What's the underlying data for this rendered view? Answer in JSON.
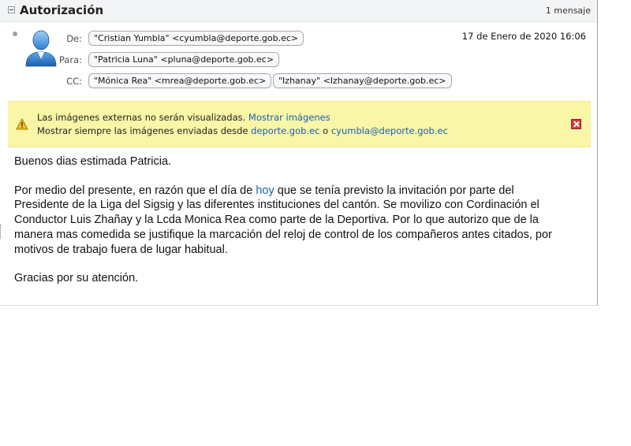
{
  "subject": "Autorización",
  "message_count": "1 mensaje",
  "header": {
    "from_label": "De:",
    "from": "\"Cristian Yumbla\" <cyumbla@deporte.gob.ec>",
    "to_label": "Para:",
    "to": "\"Patricia Luna\" <pluna@deporte.gob.ec>",
    "cc_label": "CC:",
    "cc": [
      "\"Mónica Rea\" <mrea@deporte.gob.ec>",
      "\"Izhanay\" <Izhanay@deporte.gob.ec>"
    ],
    "date": "17 de Enero de 2020 16:06"
  },
  "banner": {
    "line1_text": "Las imágenes externas no serán visualizadas.",
    "show_images_link": "Mostrar imágenes",
    "line2_text": "Mostrar siempre las imágenes enviadas desde",
    "domain_link": "deporte.gob.ec",
    "or_text": "o",
    "sender_link": "cyumbla@deporte.gob.ec"
  },
  "body": {
    "greeting": "Buenos dias estimada Patricia.",
    "para_before_link": "Por medio del presente, en razón que el día de",
    "para_link": "hoy",
    "para_after_link": "que se tenía previsto la invitación por parte del Presidente de la Liga del Sigsig y las diferentes instituciones del cantón. Se movilizo con Cordinación el Conductor Luis Zhañay y la Lcda Monica Rea como parte de la Deportiva. Por lo que autorizo que de la manera mas comedida se justifique la marcación del reloj de control de los compañeros antes citados, por motivos de trabajo fuera de lugar habitual.",
    "closing": "Gracias por su atención."
  },
  "colors": {
    "banner_bg": "#f9f6a7",
    "link": "#1a5fb4",
    "close": "#d9363e"
  },
  "icons": [
    "collapse-icon",
    "unread-indicator",
    "user-avatar-icon",
    "warning-icon",
    "close-icon"
  ]
}
